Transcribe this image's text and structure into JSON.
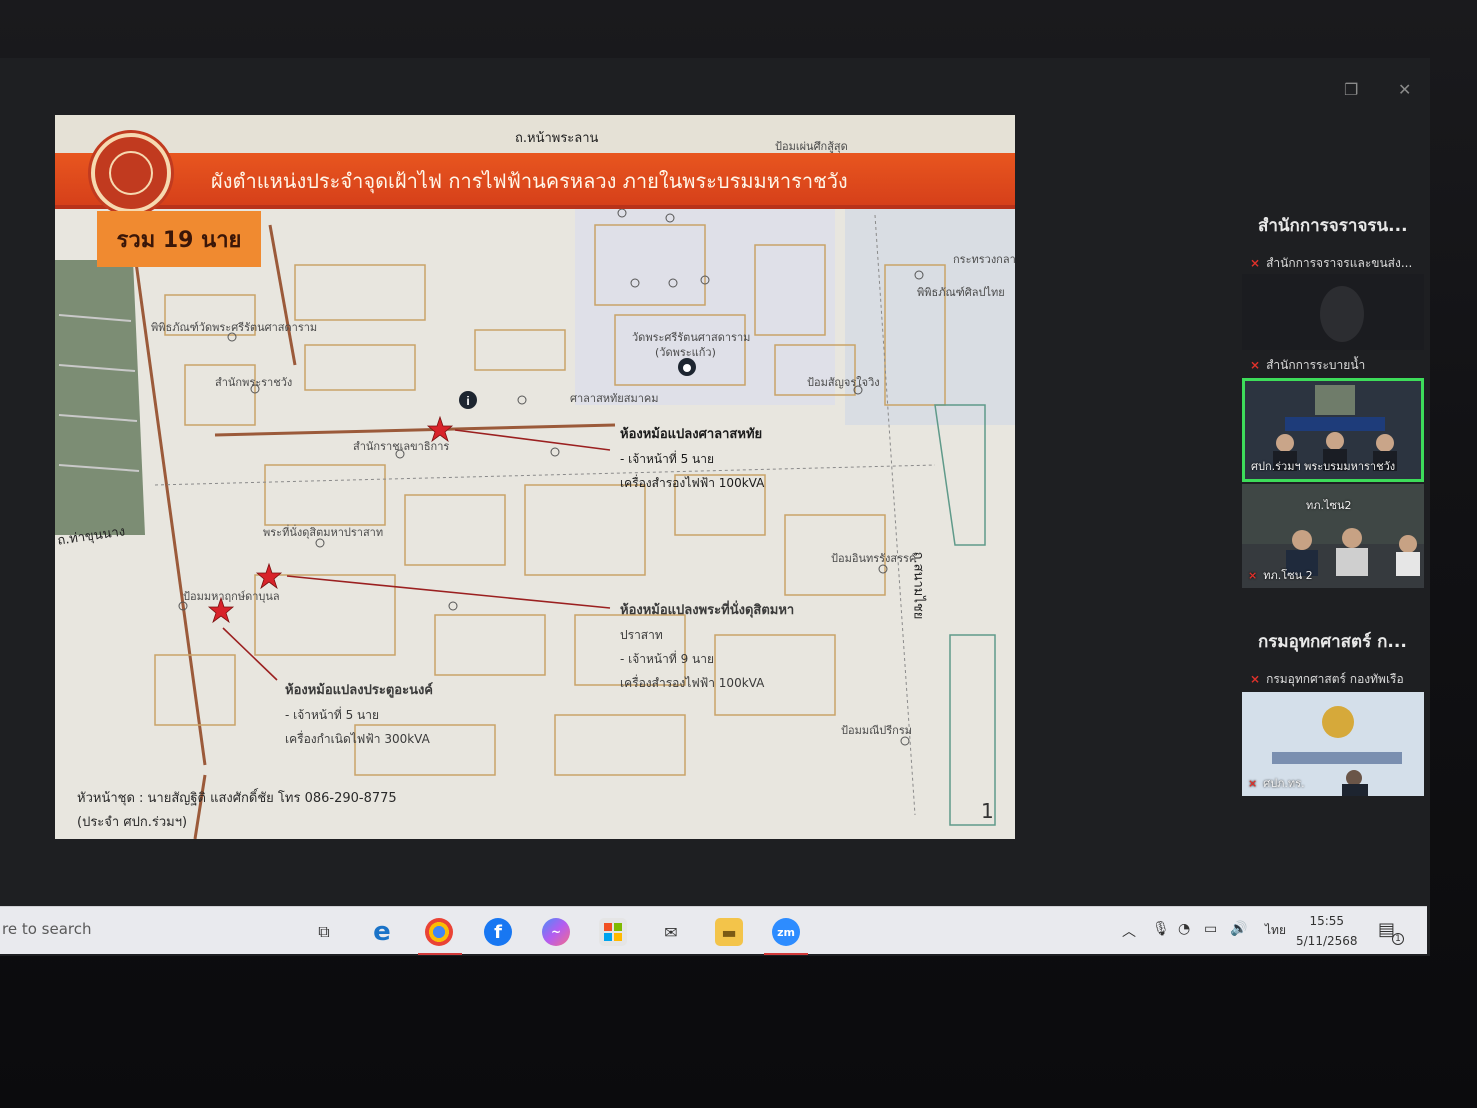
{
  "slide": {
    "title": "ผังตำแหน่งประจำจุดเฝ้าไฟ การไฟฟ้านครหลวง ภายในพระบรมมหาราชวัง",
    "total_badge": "รวม 19 นาย",
    "page_number": "1",
    "footer": {
      "line1": "หัวหน้าชุด : นายสัญฐิติ แสงศักดิ์ชัย โทร 086-290-8775",
      "line2": "(ประจำ ศปก.ร่วมฯ)"
    },
    "map_labels": {
      "road_top": "ถ.หน้าพระลาน",
      "road_left": "ถ.ท่าขุนนาง",
      "road_right": "ถ.สนามไชย",
      "top_right": "ป้อมเผ่นศึกสู้สุด",
      "label_1": "วัดพระศรีรัตนศาสดาราม",
      "label_2": "(วัดพระแก้ว)",
      "label_3": "สำนักพระราชวัง",
      "label_4": "พระที่นั่งดุสิตมหาปราสาท",
      "label_5": "ป้อมสัญจรใจวิง",
      "label_6": "ป้อมอินทรรังสรรค์",
      "label_7": "ป้อมมณีปรีกรม",
      "label_8": "พิพิธภัณฑ์วัดพระศรีรัตนศาสดาราม",
      "label_9": "ศาลาสหทัยสมาคม",
      "label_10": "สำนักราชเลขาธิการ",
      "label_11": "ป้อมมหาฤกษ์ดาบุนล",
      "label_12": "กระทรวงกลาโหม",
      "label_13": "พิพิธภัณฑ์ศิลปไทย"
    },
    "callouts": [
      {
        "title": "ห้องหม้อแปลงศาลาสหทัย",
        "line1": "- เจ้าหน้าที่ 5 นาย",
        "line2": "เครื่องสำรองไฟฟ้า 100kVA"
      },
      {
        "title": "ห้องหม้อแปลงพระที่นั่งดุสิตมหา",
        "title2": "ปราสาท",
        "line1": "- เจ้าหน้าที่ 9 นาย",
        "line2": "เครื่องสำรองไฟฟ้า 100kVA"
      },
      {
        "title": "ห้องหม้อแปลงประตูอะนงค์",
        "line1": "- เจ้าหน้าที่ 5 นาย",
        "line2": "เครื่องกำเนิดไฟฟ้า 300kVA"
      }
    ]
  },
  "participants": {
    "group1_title": "สำนักการจราจรน...",
    "group1_member1": "สำนักการจราจรและขนส่ง...",
    "group1_member2": "สำนักการระบายน้ำ",
    "tile_active_name": "ศปก.ร่วมฯ พระบรมมหาราชวัง",
    "tile_3_header": "ทภ.ไซน2",
    "tile_3_name": "ทภ.โซน 2",
    "group2_title": "กรมอุทกศาสตร์ ก...",
    "group2_member1": "กรมอุทกศาสตร์ กองทัพเรือ",
    "tile_4_name": "ศปภ.ทร."
  },
  "taskbar": {
    "search_text": "re to search",
    "time": "15:55",
    "date": "5/11/2568",
    "ime": "ไทย",
    "notification_count": "1",
    "apps": [
      "task-view",
      "edge",
      "chrome",
      "facebook",
      "messenger",
      "store",
      "mail",
      "file-explorer",
      "zoom"
    ]
  },
  "colors": {
    "banner": "#d6401a",
    "badge": "#f08a30",
    "marker": "#d8232a",
    "active_tile": "#3ddc5a"
  }
}
